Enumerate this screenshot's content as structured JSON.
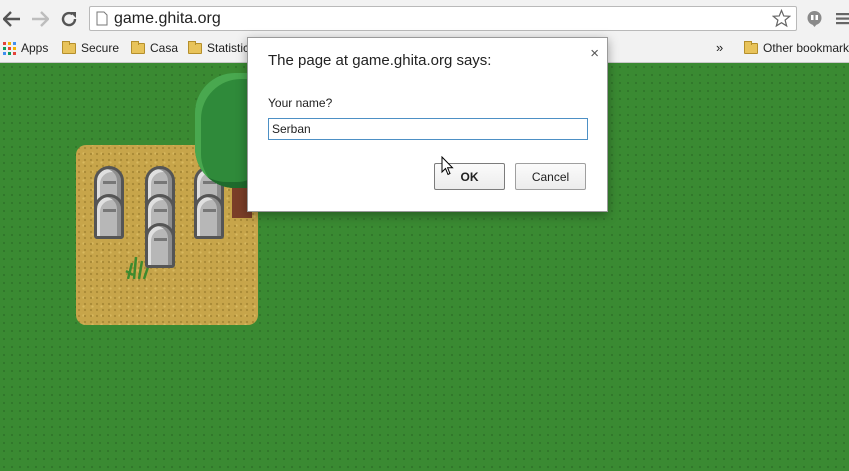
{
  "browser": {
    "url": "game.ghita.org",
    "bookmarks": [
      {
        "label": "Apps",
        "icon": "apps-grid-icon"
      },
      {
        "label": "Secure",
        "icon": "folder-icon"
      },
      {
        "label": "Casa",
        "icon": "folder-icon"
      },
      {
        "label": "Statistic",
        "icon": "folder-icon"
      }
    ],
    "overflow_label": "»",
    "other_bookmarks": "Other bookmarks"
  },
  "dialog": {
    "title": "The page at game.ghita.org says:",
    "close_glyph": "×",
    "message": "Your name?",
    "input_value": "Serban",
    "ok_label": "OK",
    "cancel_label": "Cancel"
  },
  "colors": {
    "grass": "#3a8a32",
    "dirt": "#c7a54a",
    "input_focus_border": "#4d90c5"
  }
}
